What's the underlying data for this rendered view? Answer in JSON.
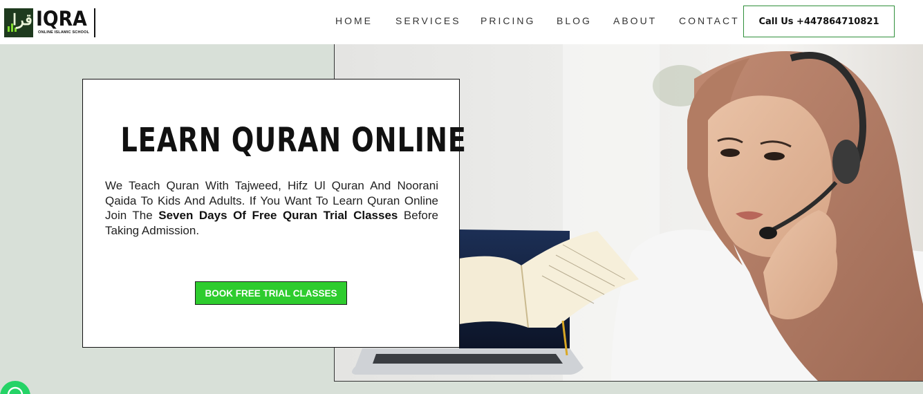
{
  "brand": {
    "name": "IQRA",
    "tagline": "ONLINE ISLAMIC SCHOOL",
    "logo_glyph": "اقرا"
  },
  "nav": {
    "items": [
      {
        "label": "HOME"
      },
      {
        "label": "SERVICES"
      },
      {
        "label": "PRICING"
      },
      {
        "label": "BLOG"
      },
      {
        "label": "ABOUT"
      },
      {
        "label": "CONTACT"
      }
    ],
    "call_label": "Call Us +447864710821"
  },
  "hero": {
    "title": "LEARN QURAN ONLINE",
    "desc_before": "We Teach Quran With Tajweed, Hifz Ul Quran And Noorani Qaida To Kids And Adults. If You Want To Learn Quran Online Join The ",
    "desc_bold": "Seven Days Of Free Quran Trial Classes",
    "desc_after": " Before Taking Admission.",
    "cta_label": "BOOK FREE TRIAL CLASSES"
  },
  "colors": {
    "accent_green": "#2ecc2e",
    "call_border": "#2f8f3a",
    "page_bg": "#d8e0d8",
    "whatsapp": "#25d366"
  },
  "icons": {
    "whatsapp": "whatsapp-icon"
  }
}
